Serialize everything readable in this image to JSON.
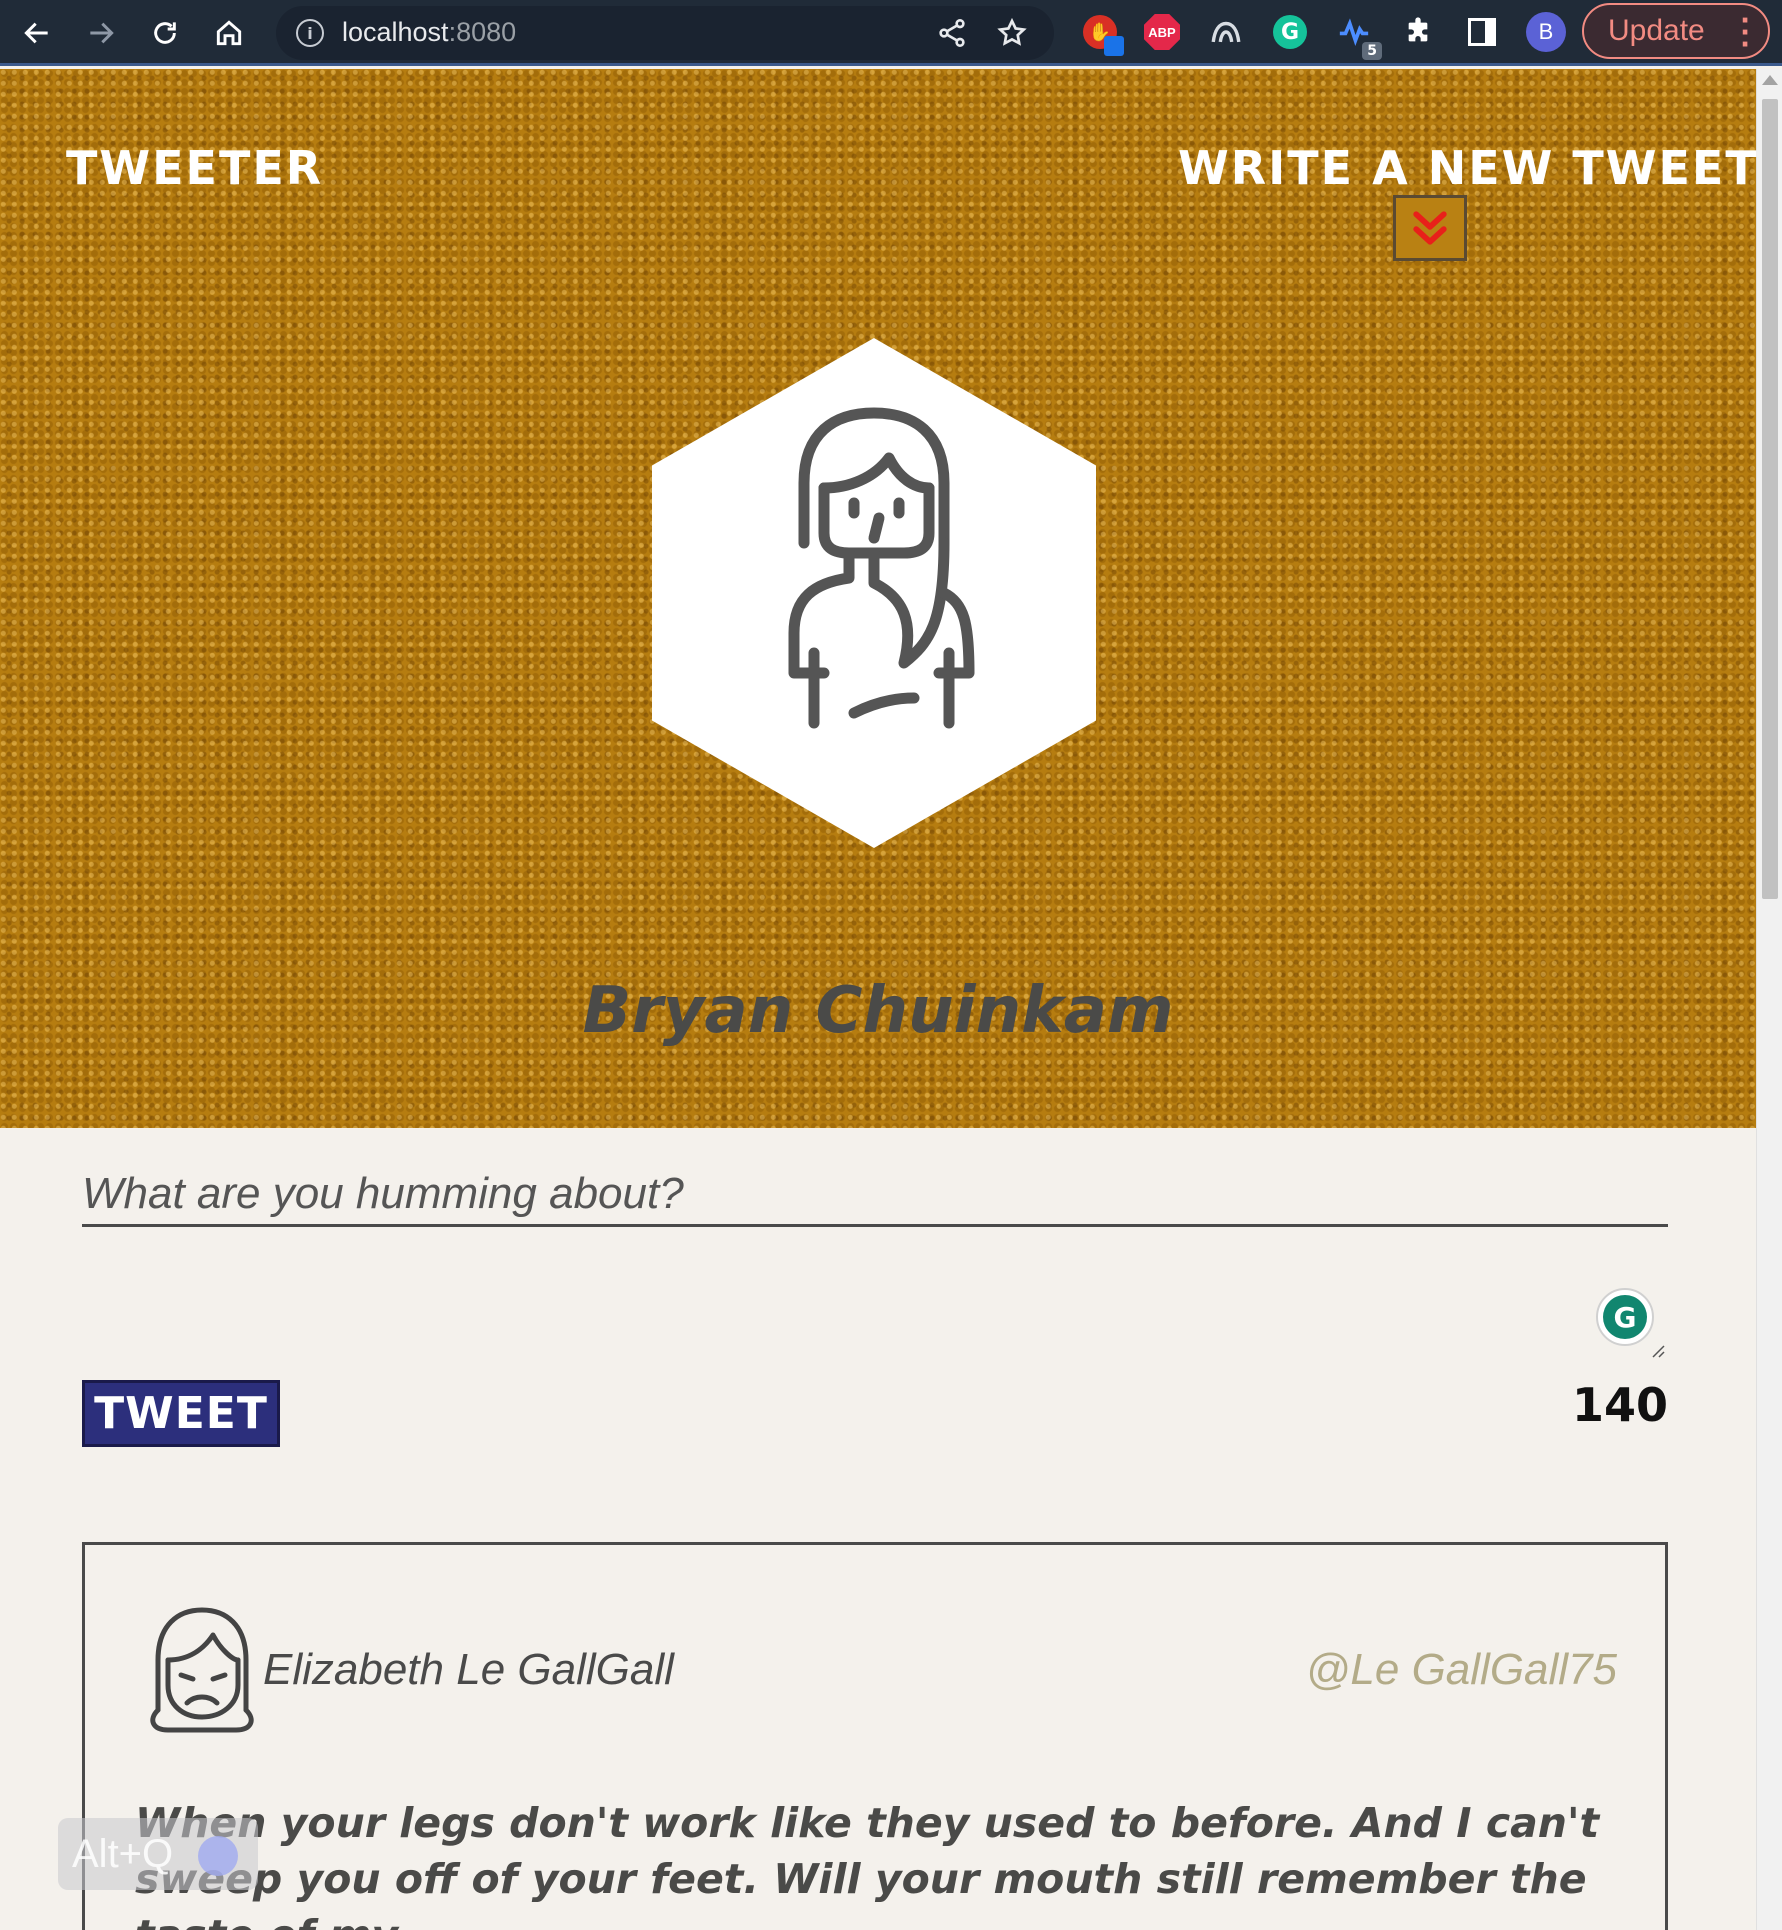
{
  "browser": {
    "url_host": "localhost",
    "url_port": ":8080",
    "profile_initial": "B",
    "update_label": "Update",
    "extensions": {
      "abp_label": "ABP",
      "grammarly_label": "G",
      "wave_badge": "5"
    },
    "icons": [
      "back-arrow-icon",
      "forward-arrow-icon",
      "reload-icon",
      "home-icon",
      "info-icon",
      "share-icon",
      "star-icon",
      "puzzle-icon",
      "side-panel-icon"
    ]
  },
  "header": {
    "brand": "TWEETER",
    "compose_link": "WRITE A NEW TWEET",
    "chevron_icon": "double-chevron-down-icon",
    "chevron_color": "#e8201a",
    "background_color": "#b67d10"
  },
  "profile": {
    "name": "Bryan Chuinkam",
    "avatar_icon": "woman-avatar-icon"
  },
  "compose": {
    "placeholder": "What are you humming about?",
    "submit_label": "TWEET",
    "char_counter": "140",
    "grammarly_label": "G",
    "button_color": "#2c2f7c"
  },
  "tweets": [
    {
      "author_name": "Elizabeth Le GallGall",
      "author_handle": "@Le GallGall75",
      "avatar_icon": "sad-woman-avatar-icon",
      "content": "When your legs don't work like they used to before. And I can't sweep you off of your feet. Will your mouth still remember the taste of my"
    }
  ],
  "overlay": {
    "shortcut": "Alt+Q"
  }
}
